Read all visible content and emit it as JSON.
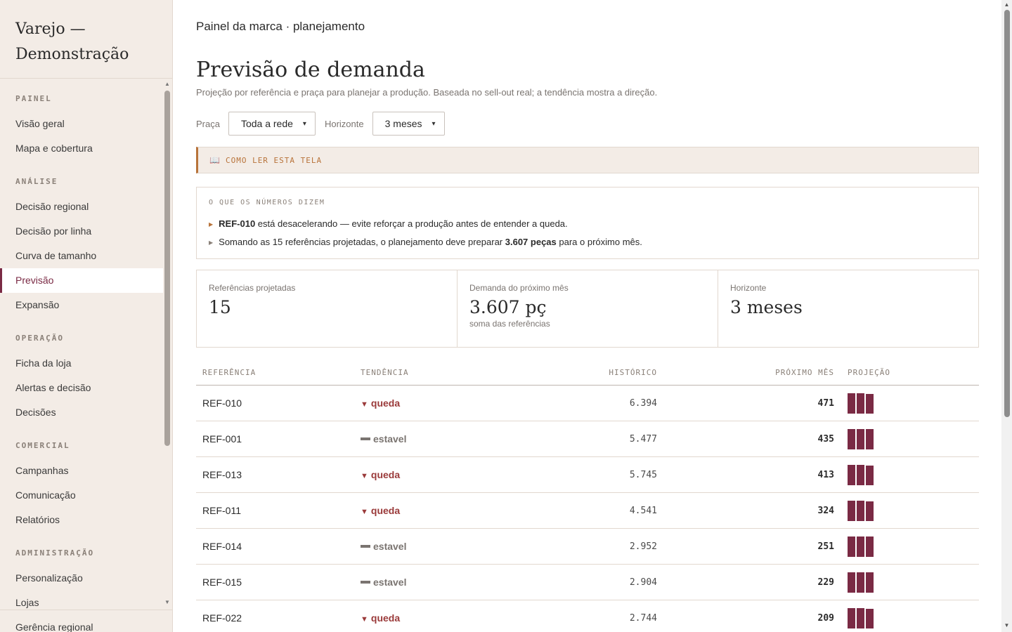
{
  "brand": {
    "line1": "Varejo —",
    "line2": "Demonstração"
  },
  "sidebar": {
    "sections": [
      {
        "title": "PAINEL",
        "items": [
          "Visão geral",
          "Mapa e cobertura"
        ]
      },
      {
        "title": "ANÁLISE",
        "items": [
          "Decisão regional",
          "Decisão por linha",
          "Curva de tamanho",
          "Previsão",
          "Expansão"
        ]
      },
      {
        "title": "OPERAÇÃO",
        "items": [
          "Ficha da loja",
          "Alertas e decisão",
          "Decisões"
        ]
      },
      {
        "title": "COMERCIAL",
        "items": [
          "Campanhas",
          "Comunicação",
          "Relatórios"
        ]
      },
      {
        "title": "ADMINISTRAÇÃO",
        "items": [
          "Personalização",
          "Lojas"
        ]
      }
    ],
    "active": "Previsão",
    "footer": "Gerência regional"
  },
  "breadcrumb": "Painel da marca · planejamento",
  "page": {
    "title": "Previsão de demanda",
    "subtitle": "Projeção por referência e praça para planejar a produção. Baseada no sell-out real; a tendência mostra a direção."
  },
  "filters": {
    "praca_label": "Praça",
    "praca_value": "Toda a rede",
    "horizonte_label": "Horizonte",
    "horizonte_value": "3 meses"
  },
  "howto": {
    "icon": "book-icon",
    "label": "COMO LER ESTA TELA"
  },
  "insights": {
    "heading": "O QUE OS NÚMEROS DIZEM",
    "line1_bold": "REF-010",
    "line1_rest": " está desacelerando — evite reforçar a produção antes de entender a queda.",
    "line2_pre": "Somando as 15 referências projetadas, o planejamento deve preparar ",
    "line2_bold": "3.607 peças",
    "line2_post": " para o próximo mês."
  },
  "kpis": [
    {
      "label": "Referências projetadas",
      "value": "15",
      "note": ""
    },
    {
      "label": "Demanda do próximo mês",
      "value": "3.607 pç",
      "note": "soma das referências"
    },
    {
      "label": "Horizonte",
      "value": "3 meses",
      "note": ""
    }
  ],
  "table": {
    "headers": {
      "ref": "REFERÊNCIA",
      "trend": "TENDÊNCIA",
      "hist": "HISTÓRICO",
      "next": "PRÓXIMO MÊS",
      "proj": "PROJEÇÃO"
    },
    "rows": [
      {
        "ref": "REF-010",
        "trend": "queda",
        "hist": "6.394",
        "next": "471",
        "proj": [
          1.0,
          1.0,
          0.96
        ]
      },
      {
        "ref": "REF-001",
        "trend": "estavel",
        "hist": "5.477",
        "next": "435",
        "proj": [
          1.0,
          1.0,
          1.0
        ]
      },
      {
        "ref": "REF-013",
        "trend": "queda",
        "hist": "5.745",
        "next": "413",
        "proj": [
          1.0,
          1.0,
          0.96
        ]
      },
      {
        "ref": "REF-011",
        "trend": "queda",
        "hist": "4.541",
        "next": "324",
        "proj": [
          1.0,
          1.0,
          0.96
        ]
      },
      {
        "ref": "REF-014",
        "trend": "estavel",
        "hist": "2.952",
        "next": "251",
        "proj": [
          1.0,
          1.0,
          1.0
        ]
      },
      {
        "ref": "REF-015",
        "trend": "estavel",
        "hist": "2.904",
        "next": "229",
        "proj": [
          1.0,
          1.0,
          1.0
        ]
      },
      {
        "ref": "REF-022",
        "trend": "queda",
        "hist": "2.744",
        "next": "209",
        "proj": [
          1.0,
          1.0,
          0.96
        ]
      }
    ]
  },
  "colors": {
    "accent": "#7a2a44",
    "down": "#9a3a3a",
    "highlight": "#b8733a",
    "sidebar_bg": "#f3ece6"
  }
}
